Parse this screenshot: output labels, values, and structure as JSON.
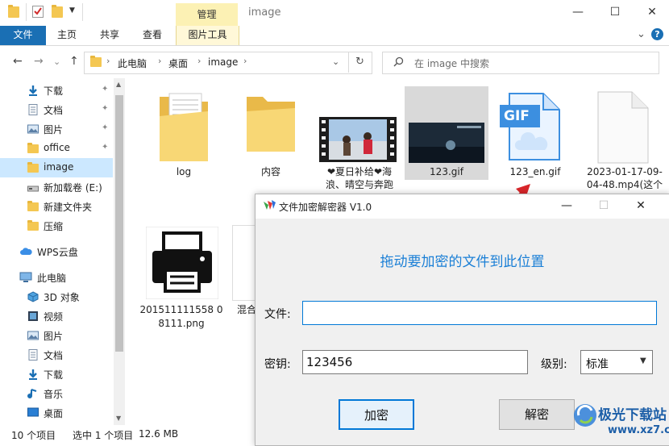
{
  "window": {
    "title": "image",
    "contextual_tab_group": "管理",
    "controls": {
      "minimize": "—",
      "maximize": "☐",
      "close": "✕"
    }
  },
  "ribbon": {
    "tabs": [
      "文件",
      "主页",
      "共享",
      "查看",
      "图片工具"
    ],
    "chevron": "⌄",
    "help": "?"
  },
  "nav": {
    "back": "←",
    "forward": "→",
    "recent": "⌄",
    "up": "↑",
    "breadcrumb": [
      "此电脑",
      "桌面",
      "image"
    ],
    "separator": "›",
    "dropdown": "⌄",
    "refresh": "↻",
    "search_placeholder": "在 image 中搜索"
  },
  "sidebar": {
    "items": [
      {
        "label": "下载",
        "icon": "download-icon",
        "pinned": true
      },
      {
        "label": "文档",
        "icon": "document-icon",
        "pinned": true
      },
      {
        "label": "图片",
        "icon": "picture-icon",
        "pinned": true
      },
      {
        "label": "office",
        "icon": "folder-icon",
        "pinned": true
      },
      {
        "label": "image",
        "icon": "folder-icon",
        "pinned": false,
        "selected": true
      },
      {
        "label": "新加载卷 (E:)",
        "icon": "drive-icon",
        "pinned": false
      },
      {
        "label": "新建文件夹",
        "icon": "folder-icon",
        "pinned": false
      },
      {
        "label": "压缩",
        "icon": "folder-icon",
        "pinned": false
      },
      {
        "label": "WPS云盘",
        "icon": "cloud-icon",
        "pinned": false
      },
      {
        "label": "此电脑",
        "icon": "computer-icon",
        "pinned": false
      },
      {
        "label": "3D 对象",
        "icon": "cube-icon",
        "pinned": false
      },
      {
        "label": "视频",
        "icon": "video-icon",
        "pinned": false
      },
      {
        "label": "图片",
        "icon": "picture-icon",
        "pinned": false
      },
      {
        "label": "文档",
        "icon": "document-icon",
        "pinned": false
      },
      {
        "label": "下载",
        "icon": "download-icon",
        "pinned": false
      },
      {
        "label": "音乐",
        "icon": "music-icon",
        "pinned": false
      },
      {
        "label": "桌面",
        "icon": "desktop-icon",
        "pinned": false
      }
    ],
    "pin_glyph": "📌"
  },
  "files": [
    {
      "name": "log",
      "type": "folder-with-docs"
    },
    {
      "name": "内容",
      "type": "folder"
    },
    {
      "name_line1": "❤夏日补给❤海",
      "name_line2": "浪、晴空与奔跑",
      "type": "video"
    },
    {
      "name": "123.gif",
      "type": "gif-thumbnail",
      "selected": true
    },
    {
      "name": "123_en.gif",
      "type": "gif-file",
      "badge": "GIF"
    },
    {
      "name_line1": "2023-01-17-09-",
      "name_line2": "04-48.mp4(这个",
      "type": "blank-file"
    },
    {
      "name_line1": "201511111558 0",
      "name_line2": "8111.png",
      "type": "printer-image"
    },
    {
      "name": "混合",
      "type": "partial"
    }
  ],
  "status": {
    "count": "10 个项目",
    "selected": "选中 1 个项目",
    "size": "12.6 MB"
  },
  "dialog": {
    "title": "文件加密解密器 V1.0",
    "drop_hint": "拖动要加密的文件到此位置",
    "file_label": "文件:",
    "file_value": "",
    "key_label": "密钥:",
    "key_value": "123456",
    "level_label": "级别:",
    "level_value": "标准",
    "encrypt_label": "加密",
    "decrypt_label": "解密",
    "controls": {
      "minimize": "—",
      "maximize": "☐",
      "close": "✕"
    }
  },
  "watermark": {
    "line1": "极光下载站",
    "line2": "www.xz7.com"
  },
  "colors": {
    "accent": "#1a6fb4",
    "selection": "#cce8ff",
    "manage_tab": "#fcf1b4",
    "drop_hint": "#1a7fd6",
    "arrow": "#d9262a"
  }
}
